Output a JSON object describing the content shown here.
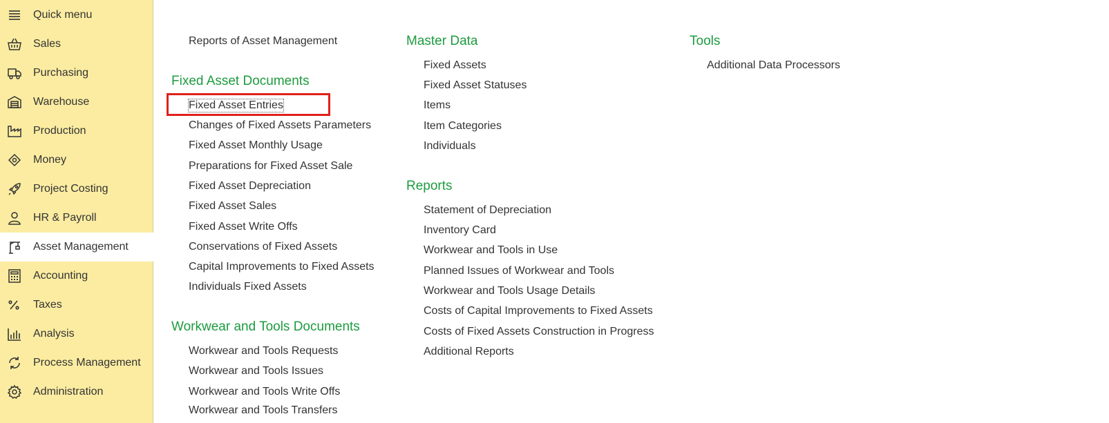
{
  "sidebar": {
    "items": [
      {
        "label": "Quick menu",
        "icon": "menu-icon"
      },
      {
        "label": "Sales",
        "icon": "basket-icon"
      },
      {
        "label": "Purchasing",
        "icon": "truck-icon"
      },
      {
        "label": "Warehouse",
        "icon": "warehouse-icon"
      },
      {
        "label": "Production",
        "icon": "factory-icon"
      },
      {
        "label": "Money",
        "icon": "money-icon"
      },
      {
        "label": "Project Costing",
        "icon": "rocket-icon"
      },
      {
        "label": "HR & Payroll",
        "icon": "person-icon"
      },
      {
        "label": "Asset Management",
        "icon": "crane-icon",
        "active": true
      },
      {
        "label": "Accounting",
        "icon": "calculator-icon"
      },
      {
        "label": "Taxes",
        "icon": "percent-icon"
      },
      {
        "label": "Analysis",
        "icon": "bar-chart-icon"
      },
      {
        "label": "Process Management",
        "icon": "cycle-icon"
      },
      {
        "label": "Administration",
        "icon": "gear-icon"
      }
    ]
  },
  "columns": {
    "col1": {
      "top_link": "Reports of Asset Management",
      "fixed_asset_docs": {
        "heading": "Fixed Asset Documents",
        "links": [
          "Fixed Asset Entries",
          "Changes of Fixed Assets Parameters",
          "Fixed Asset Monthly Usage",
          "Preparations for Fixed Asset Sale",
          "Fixed Asset Depreciation",
          "Fixed Asset Sales",
          "Fixed Asset Write Offs",
          "Conservations of Fixed Assets",
          "Capital Improvements to Fixed Assets",
          "Individuals Fixed Assets"
        ]
      },
      "workwear_docs": {
        "heading": "Workwear and Tools Documents",
        "links": [
          "Workwear and Tools Requests",
          "Workwear and Tools Issues",
          "Workwear and Tools Write Offs",
          "Workwear and Tools Transfers"
        ]
      }
    },
    "col2": {
      "master_data": {
        "heading": "Master Data",
        "links": [
          "Fixed Assets",
          "Fixed Asset Statuses",
          "Items",
          "Item Categories",
          "Individuals"
        ]
      },
      "reports": {
        "heading": "Reports",
        "links": [
          "Statement of Depreciation",
          "Inventory Card",
          "Workwear and Tools in Use",
          "Planned Issues of Workwear and Tools",
          "Workwear and Tools Usage Details",
          "Costs of Capital Improvements to Fixed Assets",
          "Costs of Fixed Assets Construction in Progress",
          "Additional Reports"
        ]
      }
    },
    "col3": {
      "tools": {
        "heading": "Tools",
        "links": [
          "Additional Data Processors"
        ]
      }
    }
  },
  "colors": {
    "sidebar_bg": "#fbeca1",
    "heading_green": "#1d9b3f",
    "highlight_red": "#e0201a"
  }
}
